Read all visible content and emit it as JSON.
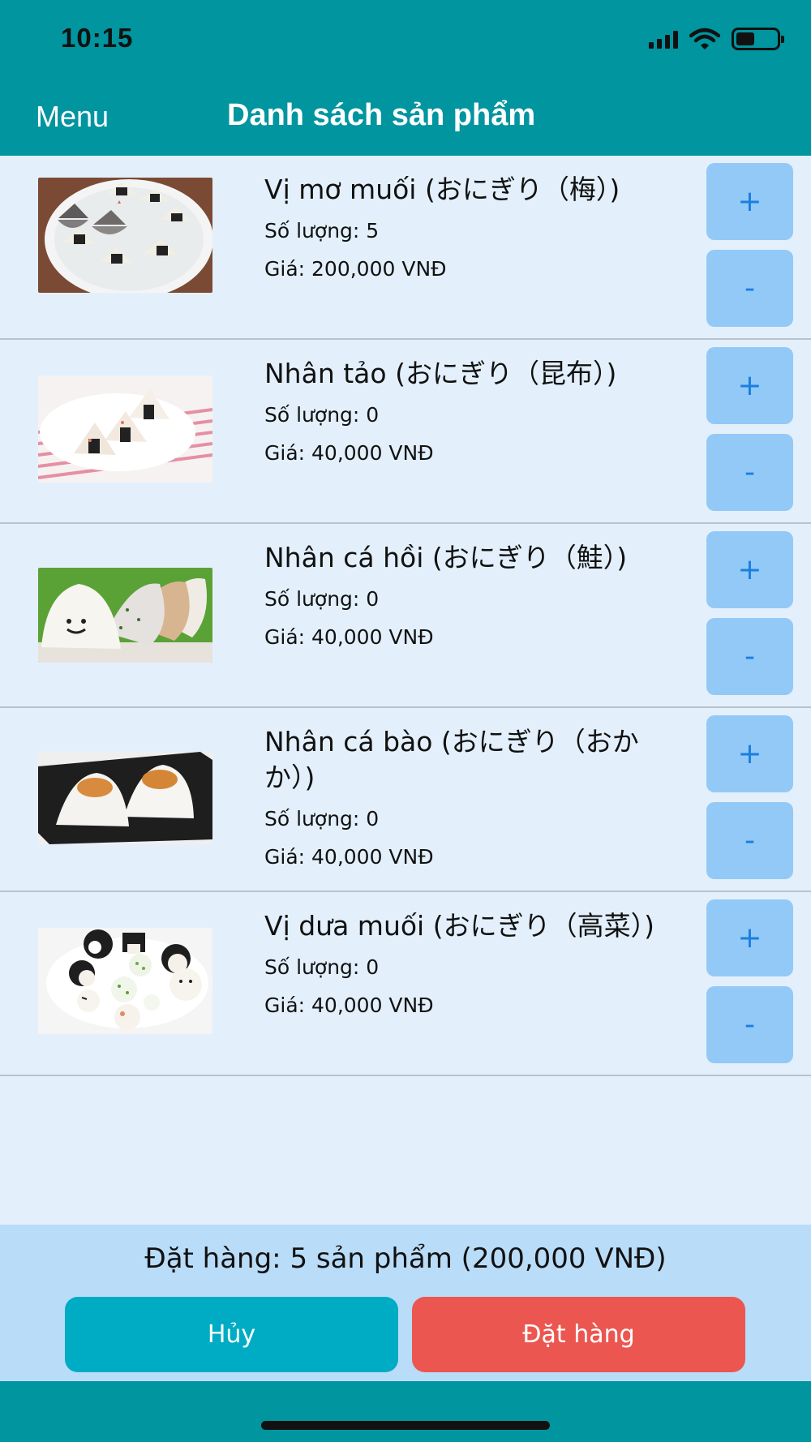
{
  "status_bar": {
    "time": "10:15",
    "battery_level": 0.45
  },
  "nav": {
    "menu_label": "Menu",
    "title": "Danh sách sản phẩm"
  },
  "products": [
    {
      "name": "Vị mơ muối (おにぎり（梅）)",
      "quantity_label": "Số lượng: 5",
      "price_label": "Giá: 200,000 VNĐ",
      "plus_label": "+",
      "minus_label": "-"
    },
    {
      "name": "Nhân tảo (おにぎり（昆布）)",
      "quantity_label": "Số lượng: 0",
      "price_label": "Giá: 40,000 VNĐ",
      "plus_label": "+",
      "minus_label": "-"
    },
    {
      "name": "Nhân cá hồi (おにぎり（鮭）)",
      "quantity_label": "Số lượng: 0",
      "price_label": "Giá: 40,000 VNĐ",
      "plus_label": "+",
      "minus_label": "-"
    },
    {
      "name": "Nhân cá bào (おにぎり（おかか）)",
      "quantity_label": "Số lượng: 0",
      "price_label": "Giá: 40,000 VNĐ",
      "plus_label": "+",
      "minus_label": "-"
    },
    {
      "name": "Vị dưa muối (おにぎり（高菜）)",
      "quantity_label": "Số lượng: 0",
      "price_label": "Giá: 40,000 VNĐ",
      "plus_label": "+",
      "minus_label": "-"
    }
  ],
  "order": {
    "summary": "Đặt hàng: 5 sản phẩm (200,000 VNĐ)",
    "cancel_label": "Hủy",
    "submit_label": "Đặt hàng"
  },
  "colors": {
    "header": "#00959f",
    "background": "#e3f0fc",
    "step_button": "#93c9f6",
    "cancel": "#00abc4",
    "submit": "#ec5650"
  }
}
